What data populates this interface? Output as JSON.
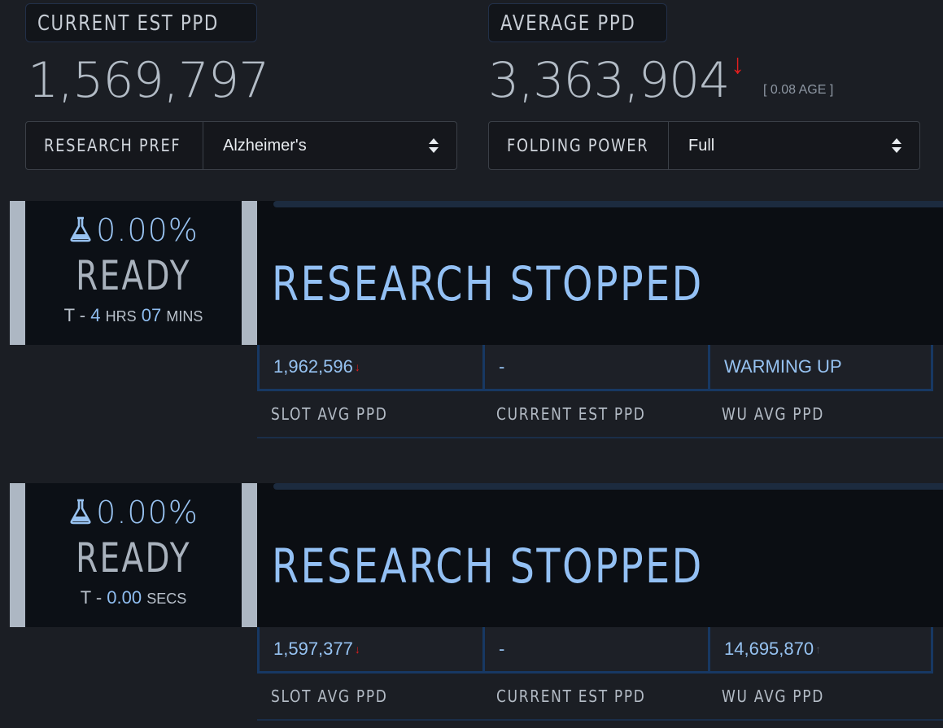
{
  "header": {
    "current": {
      "label": "CURRENT EST PPD",
      "value": "1,569,797"
    },
    "average": {
      "label": "AVERAGE PPD",
      "value": "3,363,904",
      "trend": "down",
      "age": "[ 0.08 AGE ]"
    }
  },
  "controls": {
    "research_pref": {
      "label": "RESEARCH PREF",
      "value": "Alzheimer's"
    },
    "folding_power": {
      "label": "FOLDING POWER",
      "value": "Full"
    }
  },
  "slots": [
    {
      "progress": "0.00%",
      "state": "READY",
      "timer": {
        "prefix": "T - ",
        "parts": [
          {
            "num": "4",
            "unit": "HRS"
          },
          {
            "num": "07",
            "unit": "MINS"
          }
        ]
      },
      "status": "RESEARCH STOPPED",
      "stats": [
        {
          "value": "1,962,596",
          "trend": "down"
        },
        {
          "value": "-",
          "trend": ""
        },
        {
          "value": "WARMING UP",
          "trend": ""
        }
      ],
      "labels": [
        "SLOT AVG PPD",
        "CURRENT EST PPD",
        "WU AVG PPD"
      ]
    },
    {
      "progress": "0.00%",
      "state": "READY",
      "timer": {
        "prefix": "T - ",
        "parts": [
          {
            "num": "0.00",
            "unit": "SECS"
          }
        ]
      },
      "status": "RESEARCH STOPPED",
      "stats": [
        {
          "value": "1,597,377",
          "trend": "down"
        },
        {
          "value": "-",
          "trend": ""
        },
        {
          "value": "14,695,870",
          "trend": "up"
        }
      ],
      "labels": [
        "SLOT AVG PPD",
        "CURRENT EST PPD",
        "WU AVG PPD"
      ]
    }
  ],
  "icons": {
    "flask": "flask-icon",
    "arrow_down": "arrow-down-icon",
    "arrow_up": "arrow-up-icon"
  },
  "colors": {
    "accent": "#93c0f4",
    "trend_down": "#e01e1e",
    "background": "#1b1e24"
  }
}
